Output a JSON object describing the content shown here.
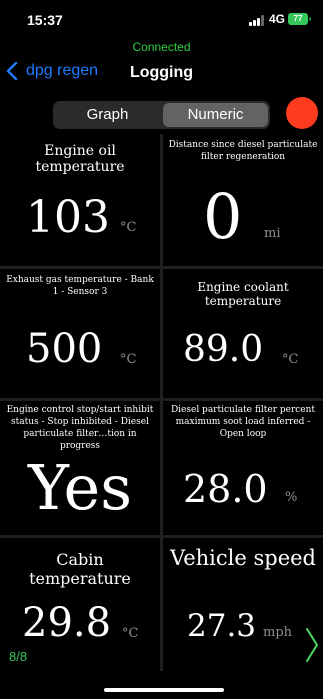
{
  "status_bar": {
    "time": "15:37",
    "network": "4G",
    "battery": "77"
  },
  "connection_status": "Connected",
  "nav": {
    "back_label": "dpg regen",
    "title": "Logging"
  },
  "view_switch": {
    "options": [
      "Graph",
      "Numeric"
    ],
    "selected": "Numeric"
  },
  "colors": {
    "accent": "#1e7bff",
    "connected": "#2fcf3f",
    "record": "#ff3b1f"
  },
  "gauges": [
    {
      "label": "Engine oil temperature",
      "value": "103",
      "unit": "°C"
    },
    {
      "label": "Distance since diesel particulate filter regeneration",
      "value": "0",
      "unit": "mi"
    },
    {
      "label": "Exhaust gas temperature  -  Bank 1  -  Sensor 3",
      "value": "500",
      "unit": "°C"
    },
    {
      "label": "Engine coolant temperature",
      "value": "89.0",
      "unit": "°C"
    },
    {
      "label": "Engine control stop/start inhibit status  -  Stop inhibited  -  Diesel particulate filter…tion in progress",
      "value": "Yes",
      "unit": ""
    },
    {
      "label": "Diesel particulate filter percent maximum soot load inferred  -  Open loop",
      "value": "28.0",
      "unit": "%"
    },
    {
      "label": "Cabin temperature",
      "value": "29.8",
      "unit": "°C"
    },
    {
      "label": "Vehicle speed",
      "value": "27.3",
      "unit": "mph"
    }
  ],
  "page_counter": "8/8"
}
